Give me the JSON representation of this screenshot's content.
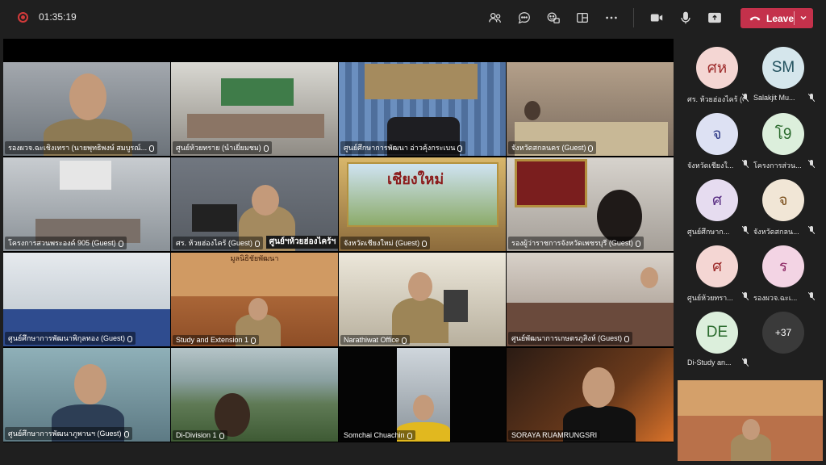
{
  "meeting": {
    "timer": "01:35:19",
    "leave_label": "Leave"
  },
  "toolbar_icons": [
    "participants-icon",
    "chat-icon",
    "reactions-icon",
    "breakout-icon",
    "more-icon",
    "camera-icon",
    "mic-icon",
    "share-icon"
  ],
  "tiles": [
    {
      "name": "รองผวจ.ฉะเชิงเทรา (นายพุทธิพงษ์ สมบูรณ์...",
      "bg": "#8a9098",
      "mic": true
    },
    {
      "name": "ศูนย์ห้วยทราย (นำเยี่ยมชม)",
      "bg": "#a7a29a",
      "mic": true
    },
    {
      "name": "ศูนย์ศึกษาการพัฒนา อ่าวคุ้งกระเบน",
      "bg": "#5a77a0",
      "mic": true
    },
    {
      "name": "จังหวัดสกลนคร (Guest)",
      "bg": "#9b8a7c",
      "mic": true
    },
    {
      "name": "โครงการสวนพระองค์ 905 (Guest)",
      "bg": "#a9b1b7",
      "mic": true
    },
    {
      "name": "ศร. ห้วยฮ่องไคร้ (Guest)",
      "bg": "#6a6f77",
      "mic": true
    },
    {
      "name": "จังหวัดเชียงใหม่ (Guest)",
      "bg": "#6b5a46",
      "mic": true
    },
    {
      "name": "รองผู้ว่าราชการจังหวัดเพชรบุรี (Guest)",
      "bg": "#b8b2aa",
      "mic": true
    },
    {
      "name": "ศูนย์ศึกษาการพัฒนาพิกุลทอง (Guest)",
      "bg": "#c7cdd3",
      "mic": true
    },
    {
      "name": "Study and Extension 1",
      "bg": "#b16a3c",
      "mic": true
    },
    {
      "name": "Narathiwat Office",
      "bg": "#c9c2b2",
      "mic": true
    },
    {
      "name": "ศูนย์พัฒนาการเกษตรภูสิงห์ (Guest)",
      "bg": "#a99a8e",
      "mic": true
    },
    {
      "name": "ศูนย์ศึกษาการพัฒนาภูพานฯ (Guest)",
      "bg": "#8aa0aa",
      "mic": true
    },
    {
      "name": "Di-Division 1",
      "bg": "#5f7a55",
      "mic": true
    },
    {
      "name": "Somchai Chuachin",
      "bg": "#2a2a2a",
      "mic": true
    },
    {
      "name": "SORAYA RUAMRUNGSRI",
      "bg": "#3c2b22",
      "mic": false
    }
  ],
  "banners": {
    "shiang_mai": "เชียงใหม่",
    "huai_hong_khrai": "ศูนย์ฯห้วยฮ่องไคร้ฯ",
    "study_title": "มูลนิธิชัยพัฒนา"
  },
  "participants": [
    {
      "initials": "ศห",
      "name": "ศร. ห้วยฮ่องไคร้ (G...",
      "bg": "#f4d6d3",
      "fg": "#9d2b2b"
    },
    {
      "initials": "SM",
      "name": "Salakjit Mu...",
      "bg": "#d5e6ec",
      "fg": "#22515e"
    },
    {
      "initials": "จ",
      "name": "จังหวัดเชียงใ...",
      "bg": "#dde1f3",
      "fg": "#2b3785"
    },
    {
      "initials": "โ9",
      "name": "โครงการส่วน...",
      "bg": "#dcefdc",
      "fg": "#2a6a2d"
    },
    {
      "initials": "ศ",
      "name": "ศูนย์ศึกษาก...",
      "bg": "#e6dcf0",
      "fg": "#5a2f84"
    },
    {
      "initials": "จ",
      "name": "จังหวัดสกลน...",
      "bg": "#f1e6d6",
      "fg": "#7a4f1c"
    },
    {
      "initials": "ศ",
      "name": "ศูนย์ห้วยทรา...",
      "bg": "#f4d6d3",
      "fg": "#9d2b2b"
    },
    {
      "initials": "ร",
      "name": "รองผวจ.ฉะเ...",
      "bg": "#f3d4e4",
      "fg": "#8a2461"
    },
    {
      "initials": "DE",
      "name": "Di-Study an...",
      "bg": "#dcefdc",
      "fg": "#2a6a2d"
    }
  ],
  "overflow_count": "+37",
  "colors": {
    "leave": "#c4314b",
    "rail_bg": "#1f1f1f",
    "stage_bg": "#000000"
  }
}
